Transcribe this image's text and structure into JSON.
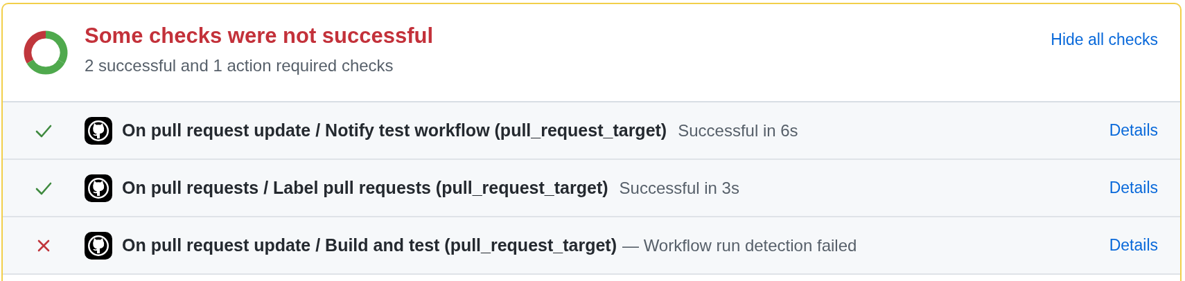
{
  "summary": {
    "title": "Some checks were not successful",
    "subtitle": "2 successful and 1 action required checks",
    "toggle_link": "Hide all checks"
  },
  "checks": [
    {
      "passed": true,
      "name": "On pull request update / Notify test workflow (pull_request_target)",
      "detail": "Successful in 6s",
      "link": "Details"
    },
    {
      "passed": true,
      "name": "On pull requests / Label pull requests (pull_request_target)",
      "detail": "Successful in 3s",
      "link": "Details"
    },
    {
      "passed": false,
      "name": "On pull request update / Build and test (pull_request_target)",
      "detail": "— Workflow run detection failed",
      "link": "Details"
    }
  ]
}
